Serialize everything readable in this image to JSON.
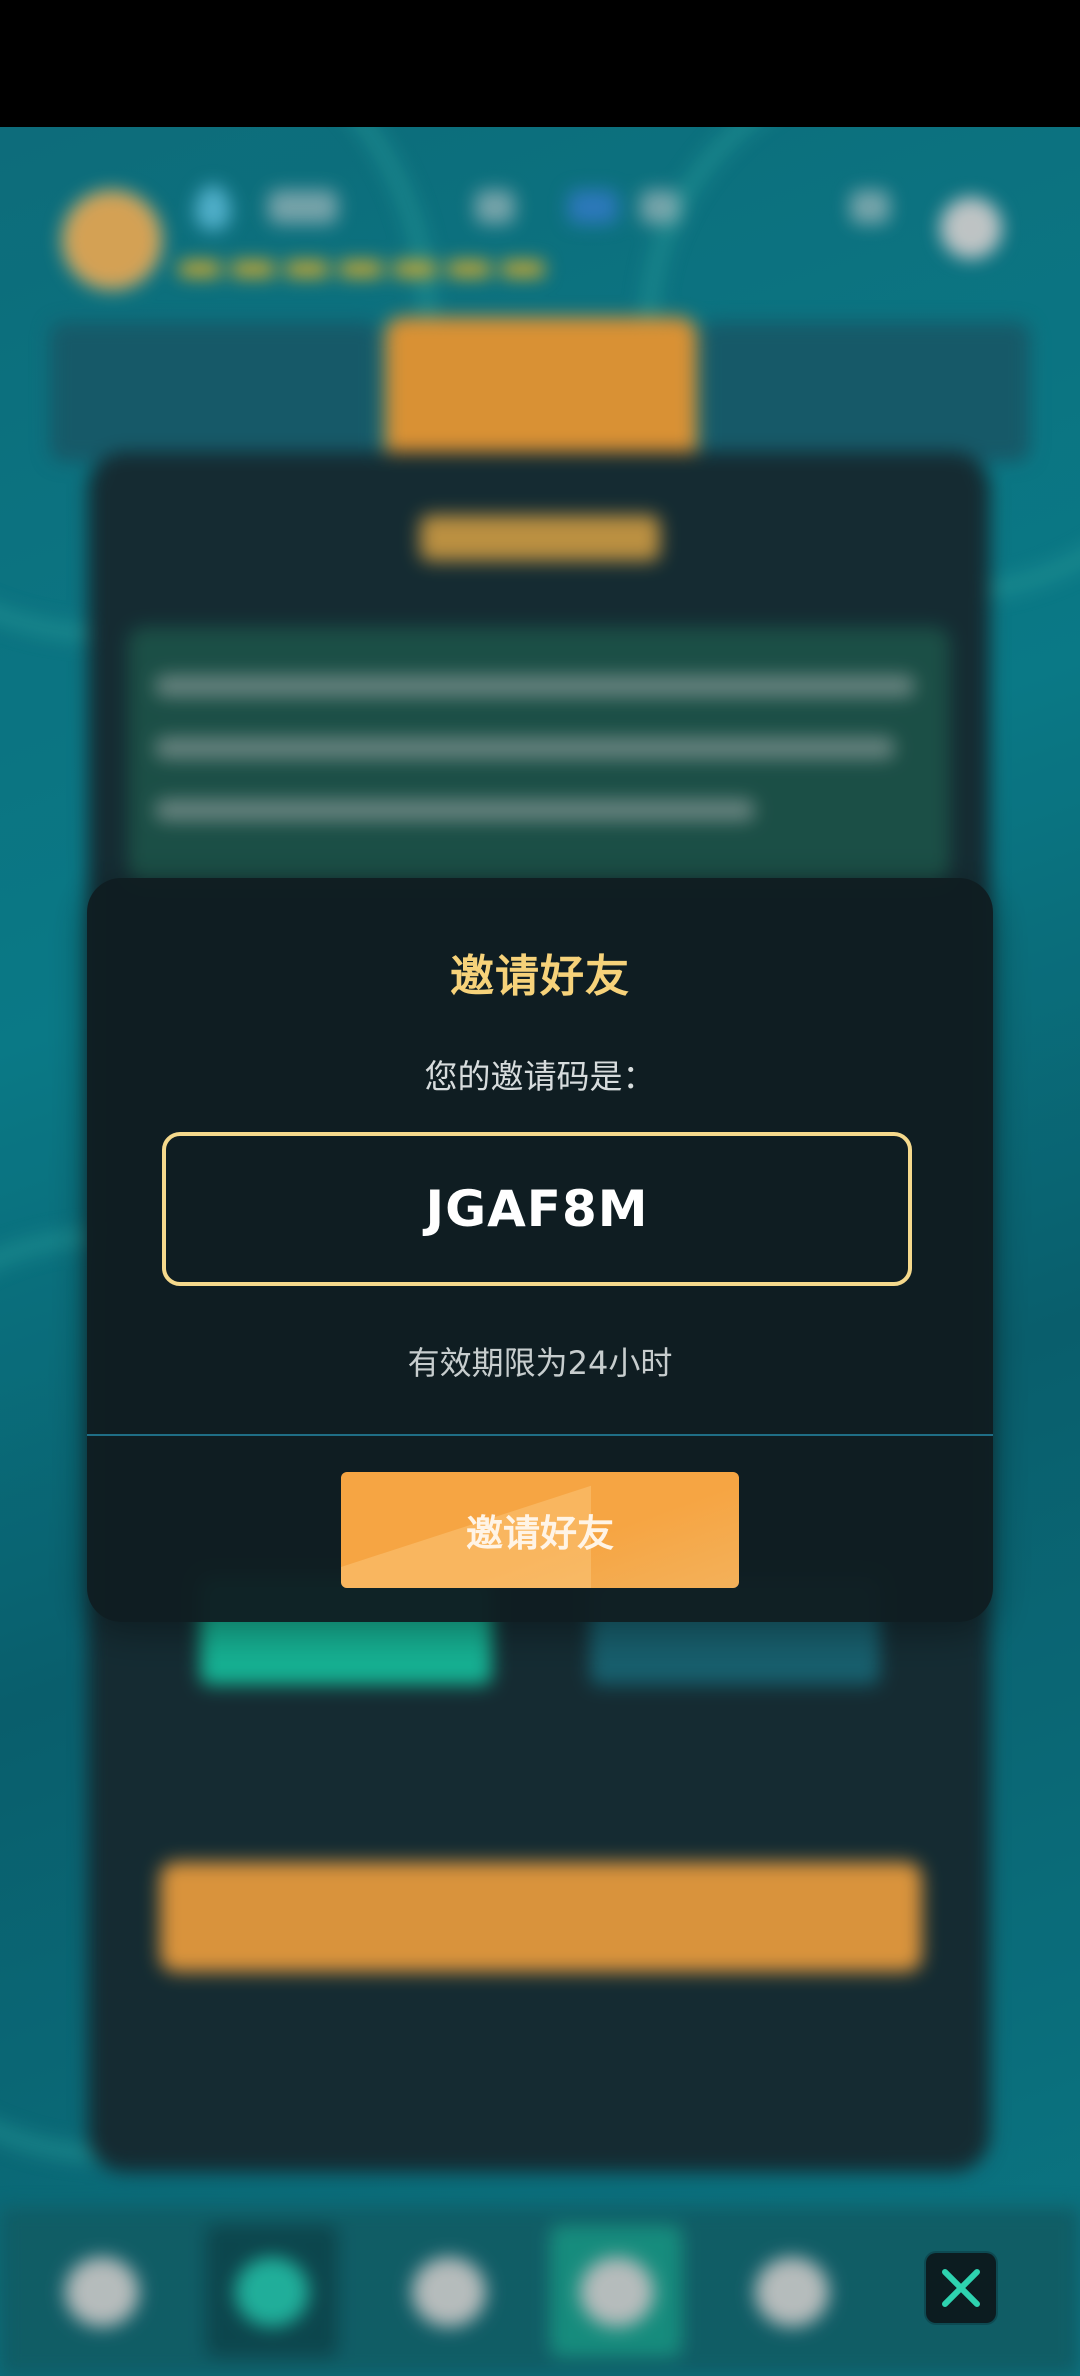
{
  "dialog": {
    "title": "邀请好友",
    "subtitle": "您的邀请码是：",
    "invite_code": "JGAF8M",
    "validity": "有效期限为24小时",
    "invite_button": "邀请好友"
  },
  "icons": {
    "close": "close-icon"
  },
  "colors": {
    "title": "#f6d27a",
    "code_border": "#f5d98c",
    "button": "#f6a543",
    "dialog_bg": "#101d21",
    "close_icon": "#2ed3b0"
  }
}
